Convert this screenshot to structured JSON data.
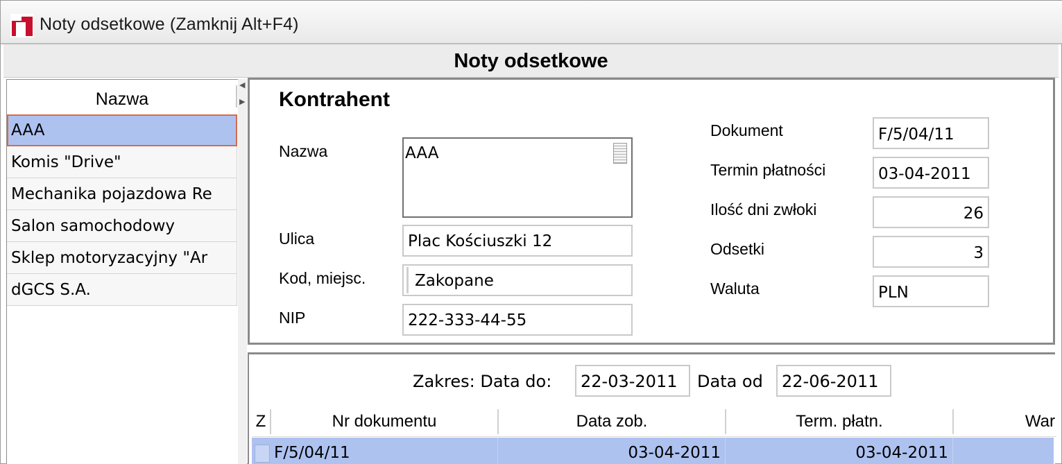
{
  "window": {
    "title": "Noty odsetkowe (Zamknij Alt+F4)",
    "header": "Noty odsetkowe"
  },
  "list": {
    "column_header": "Nazwa",
    "items": [
      "AAA",
      "Komis \"Drive\"",
      "Mechanika pojazdowa Re",
      "Salon samochodowy",
      "Sklep motoryzacyjny \"Ar",
      "dGCS S.A."
    ],
    "selected_index": 0
  },
  "contractor": {
    "title": "Kontrahent",
    "name_label": "Nazwa",
    "name_value": "AAA",
    "street_label": "Ulica",
    "street_value": "Plac Kościuszki 12",
    "city_label": "Kod, miejsc.",
    "city_value": "Zakopane",
    "nip_label": "NIP",
    "nip_value": "222-333-44-55"
  },
  "document": {
    "doc_label": "Dokument",
    "doc_value": "F/5/04/11",
    "due_label": "Termin płatności",
    "due_value": "03-04-2011",
    "delay_label": "Ilość dni zwłoki",
    "delay_value": "26",
    "interest_label": "Odsetki",
    "interest_value": "3",
    "currency_label": "Waluta",
    "currency_value": "PLN"
  },
  "range": {
    "label_to": "Zakres: Data do:",
    "date_to": "22-03-2011",
    "label_from": "Data od",
    "date_from": "22-06-2011"
  },
  "grid": {
    "columns": [
      "Z",
      "Nr dokumentu",
      "Data zob.",
      "Term. płatn.",
      "War"
    ],
    "rows": [
      {
        "doc": "F/5/04/11",
        "date": "03-04-2011",
        "due": "03-04-2011",
        "war": ""
      }
    ]
  },
  "colors": {
    "selection": "#aec2f0",
    "selection_border": "#d86a4a",
    "app_icon": "#c8102e"
  }
}
